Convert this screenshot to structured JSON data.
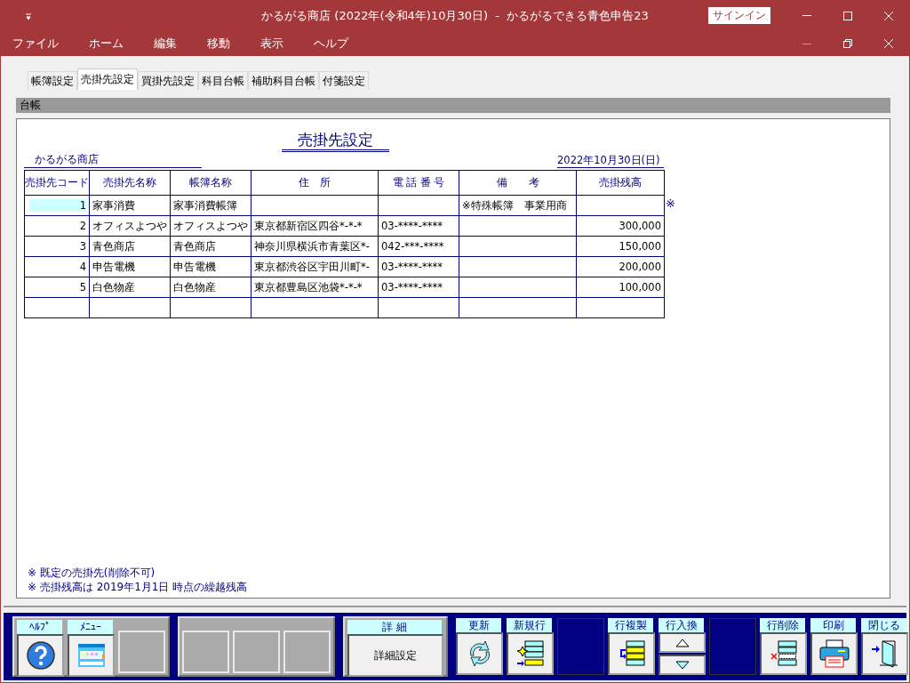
{
  "window": {
    "title": "かるがる商店 (2022年(令和4年)10月30日)  -  かるがるできる青色申告23",
    "signin": "サインイン"
  },
  "menu": [
    "ファイル",
    "ホーム",
    "編集",
    "移動",
    "表示",
    "ヘルプ"
  ],
  "tabs": [
    {
      "label": "帳簿設定",
      "selected": false
    },
    {
      "label": "売掛先設定",
      "selected": true
    },
    {
      "label": "買掛先設定",
      "selected": false
    },
    {
      "label": "科目台帳",
      "selected": false
    },
    {
      "label": "補助科目台帳",
      "selected": false
    },
    {
      "label": "付箋設定",
      "selected": false
    }
  ],
  "section_header": "台帳",
  "report": {
    "title": "売掛先設定",
    "company": "かるがる商店",
    "date": "2022年10月30日(日)"
  },
  "table": {
    "columns": [
      "売掛先コード",
      "売掛先名称",
      "帳簿名称",
      "住　所",
      "電 話 番 号",
      "備　　考",
      "売掛残高"
    ],
    "rows": [
      {
        "selected": true,
        "cells": [
          "1",
          "家事消費",
          "家事消費帳簿",
          "",
          "",
          "※特殊帳簿　事業用商",
          "",
          ""
        ],
        "mark": "※"
      },
      {
        "selected": false,
        "cells": [
          "2",
          "オフィスよつや",
          "オフィスよつや",
          "東京都新宿区四谷*-*-*",
          "03-****-****",
          "",
          "300,000"
        ]
      },
      {
        "selected": false,
        "cells": [
          "3",
          "青色商店",
          "青色商店",
          "神奈川県横浜市青葉区*-",
          "042-***-****",
          "",
          "150,000"
        ]
      },
      {
        "selected": false,
        "cells": [
          "4",
          "申告電機",
          "申告電機",
          "東京都渋谷区宇田川町*-",
          "03-****-****",
          "",
          "200,000"
        ]
      },
      {
        "selected": false,
        "cells": [
          "5",
          "白色物産",
          "白色物産",
          "東京都豊島区池袋*-*-*",
          "03-****-****",
          "",
          "100,000"
        ]
      }
    ]
  },
  "notes": [
    "※ 既定の売掛先(削除不可)",
    "※ 売掛残高は 2019年1月1日 時点の繰越残高"
  ],
  "toolbar": {
    "groups": [
      [
        {
          "kind": "help",
          "label": "ﾍﾙﾌﾟ"
        },
        {
          "kind": "menu",
          "label": "ﾒﾆｭｰ"
        },
        {
          "kind": "empty"
        }
      ],
      [
        {
          "kind": "empty"
        },
        {
          "kind": "empty"
        },
        {
          "kind": "empty"
        }
      ],
      [
        {
          "kind": "text",
          "label": "詳 細",
          "text": "詳細設定"
        }
      ]
    ],
    "buttons": [
      {
        "kind": "refresh",
        "label": "更新"
      },
      {
        "kind": "newrow",
        "label": "新規行"
      },
      {
        "kind": "blank"
      },
      {
        "kind": "copyrow",
        "label": "行複製"
      },
      {
        "kind": "swap",
        "label": "行入換"
      },
      {
        "kind": "blank"
      },
      {
        "kind": "deleterow",
        "label": "行削除"
      },
      {
        "kind": "print",
        "label": "印刷"
      },
      {
        "kind": "close",
        "label": "閉じる"
      }
    ]
  }
}
